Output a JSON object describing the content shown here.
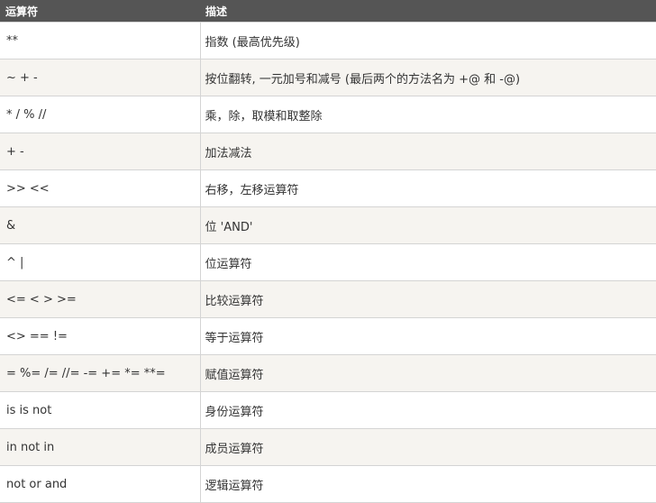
{
  "table": {
    "headers": [
      "运算符",
      "描述"
    ],
    "rows": [
      {
        "operator": "**",
        "description": "指数 (最高优先级)"
      },
      {
        "operator": "~ + -",
        "description": "按位翻转, 一元加号和减号 (最后两个的方法名为 +@ 和 -@)"
      },
      {
        "operator": "* / % //",
        "description": "乘，除，取模和取整除"
      },
      {
        "operator": "+ -",
        "description": "加法减法"
      },
      {
        "operator": ">> <<",
        "description": "右移，左移运算符"
      },
      {
        "operator": "&",
        "description": "位 'AND'"
      },
      {
        "operator": "^ |",
        "description": "位运算符"
      },
      {
        "operator": "<= < > >=",
        "description": "比较运算符"
      },
      {
        "operator": "<> == !=",
        "description": "等于运算符"
      },
      {
        "operator": "= %= /= //= -= += *= **=",
        "description": "赋值运算符"
      },
      {
        "operator": "is is not",
        "description": "身份运算符"
      },
      {
        "operator": "in not in",
        "description": "成员运算符"
      },
      {
        "operator": "not or and",
        "description": "逻辑运算符"
      }
    ]
  }
}
